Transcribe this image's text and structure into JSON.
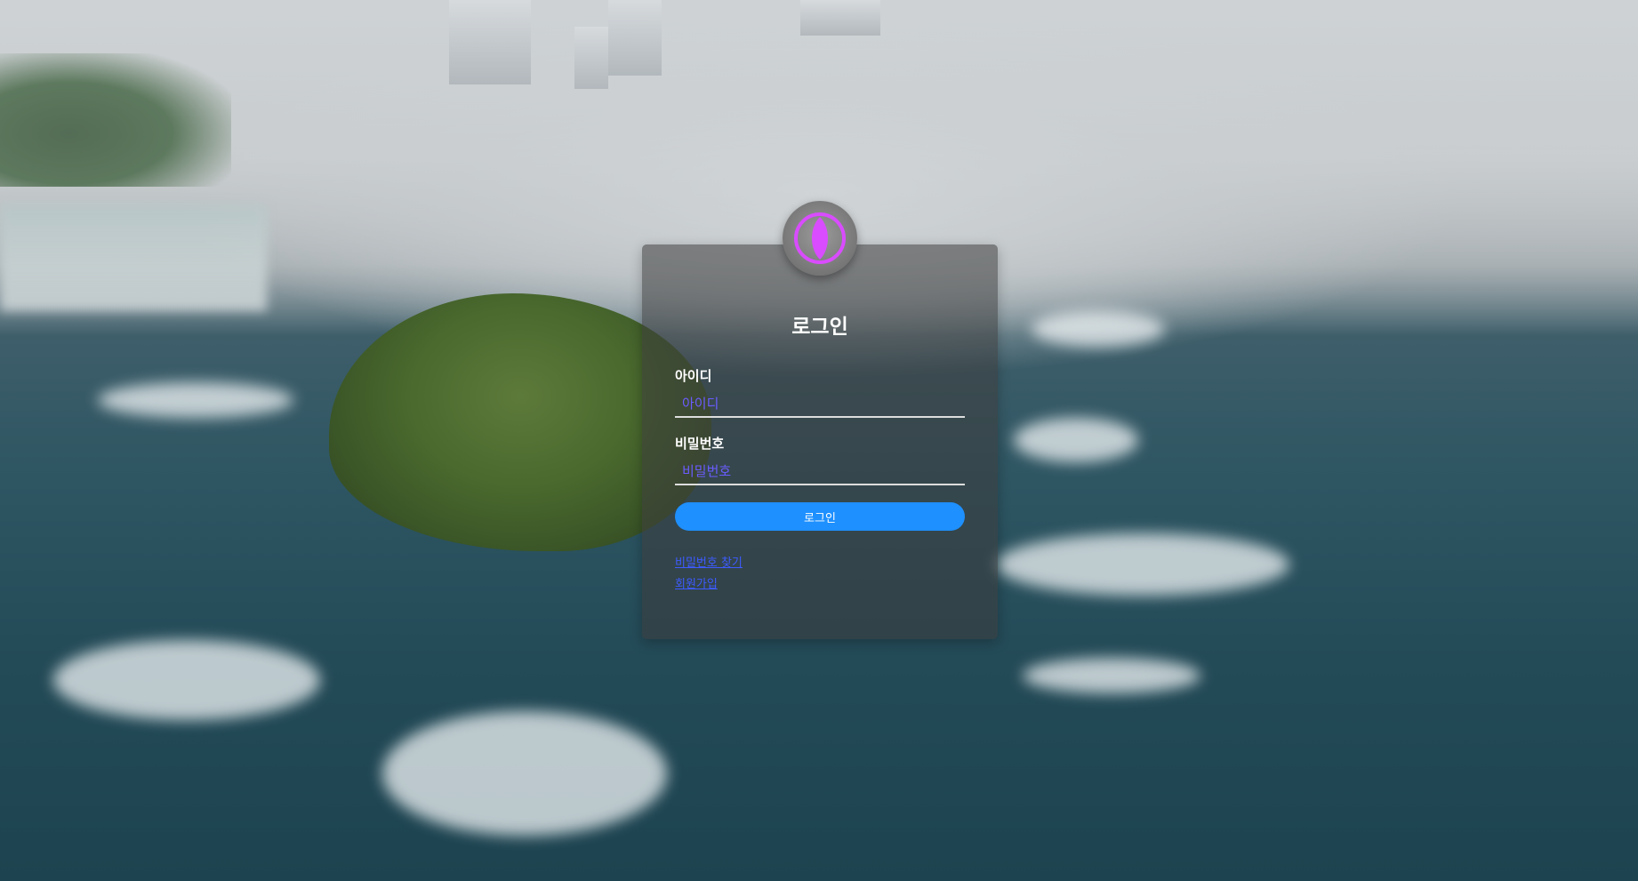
{
  "login": {
    "title": "로그인",
    "id_label": "아이디",
    "id_placeholder": "아이디",
    "password_label": "비밀번호",
    "password_placeholder": "비밀번호",
    "submit_label": "로그인",
    "find_password_link": "비밀번호 찾기",
    "signup_link": "회원가입"
  },
  "icons": {
    "logo": "logo-icon"
  },
  "colors": {
    "accent": "#1e90ff",
    "link": "#3d5bff",
    "logo_magenta": "#d94cff",
    "placeholder": "#6a5cff"
  }
}
